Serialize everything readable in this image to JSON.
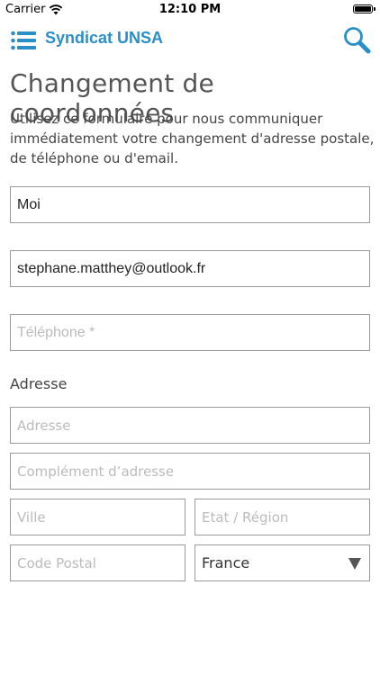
{
  "status_bar": {
    "carrier": "Carrier",
    "time": "12:10 PM"
  },
  "navbar": {
    "title": "Syndicat UNSA",
    "icons": [
      "menu-list-icon",
      "search-icon"
    ],
    "accent": "#2a8fc9"
  },
  "page": {
    "title": "Changement de coordonnées",
    "intro": "Utilisez ce formulaire pour nous communiquer immédiatement votre changement d'adresse postale, de téléphone ou d'email."
  },
  "form": {
    "name_value": "Moi",
    "email_value": "stephane.matthey@outlook.fr",
    "phone_placeholder": "Téléphone *",
    "address_section_label": "Adresse",
    "address_placeholder": "Adresse",
    "address2_placeholder": "Complément d’adresse",
    "city_placeholder": "Ville",
    "state_placeholder": "Etat / Région",
    "postal_placeholder": "Code Postal",
    "country_selected": "France"
  }
}
